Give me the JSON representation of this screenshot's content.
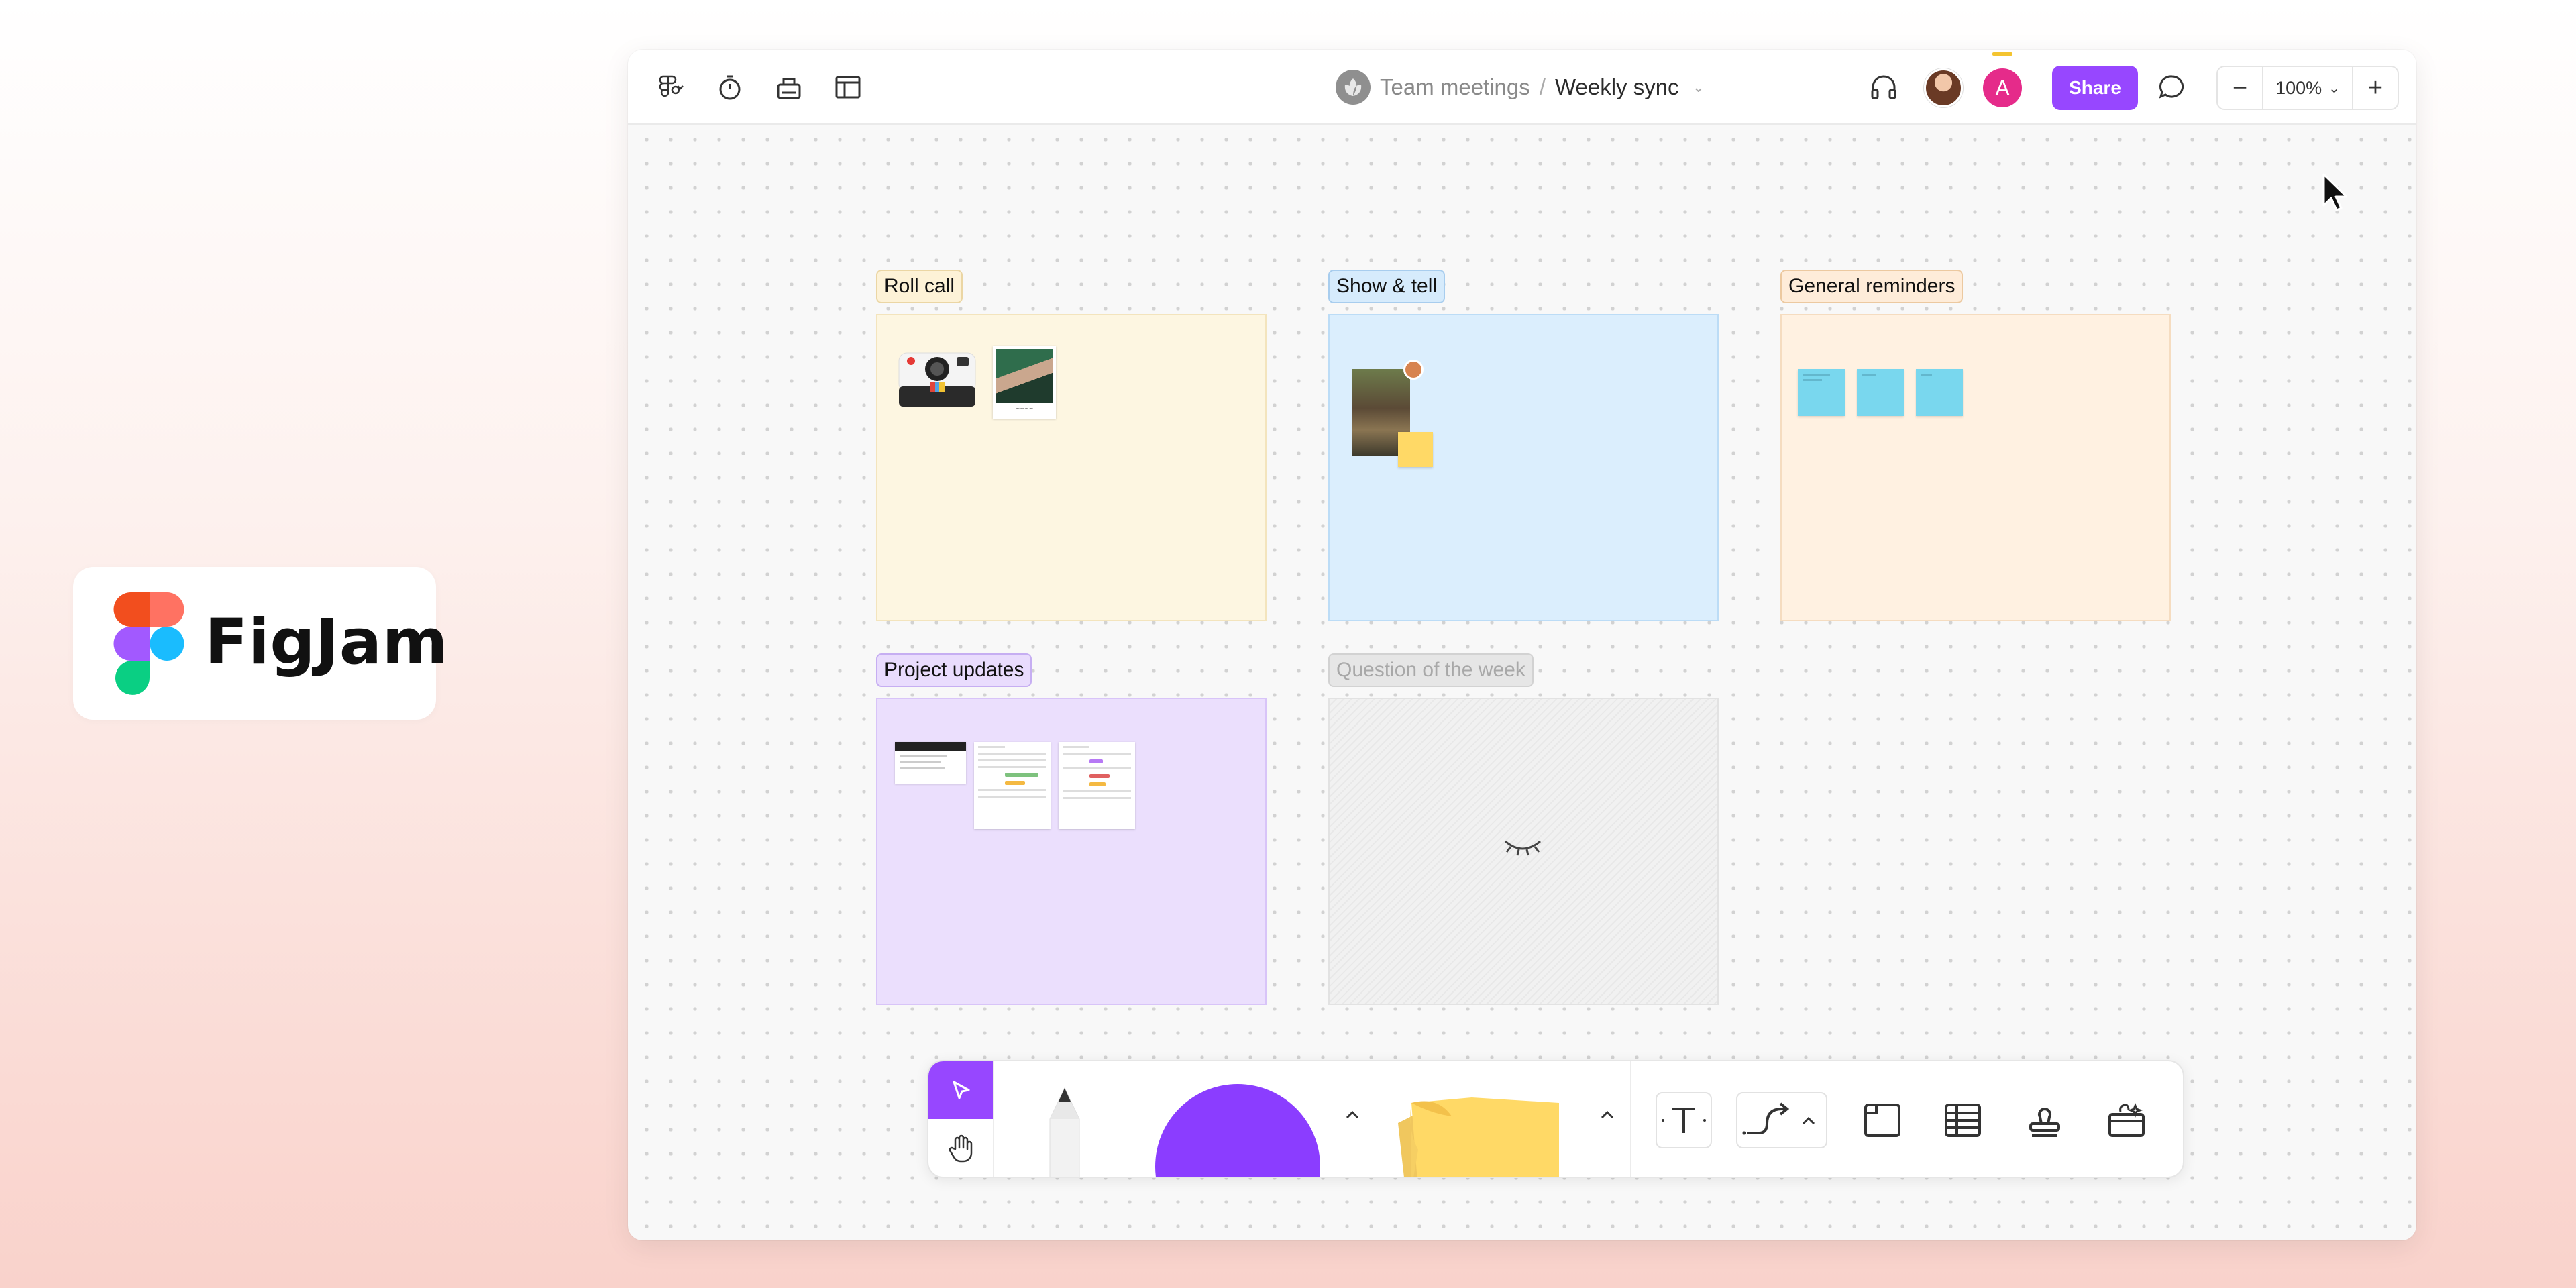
{
  "brand": {
    "name": "FigJam",
    "logo_colors": [
      "#f24e1e",
      "#ff7262",
      "#a259ff",
      "#1abcfe",
      "#0acf83"
    ]
  },
  "header": {
    "team": "Team meetings",
    "separator": "/",
    "file_name": "Weekly sync",
    "share_label": "Share",
    "avatar_initial": "A",
    "zoom": "100%",
    "zoom_out": "−",
    "zoom_in": "+"
  },
  "sections": [
    {
      "title": "Roll call",
      "color": "#fdf6e1"
    },
    {
      "title": "Show & tell",
      "color": "#dbeefd"
    },
    {
      "title": "General reminders",
      "color": "#fff1e1"
    },
    {
      "title": "Project updates",
      "color": "#ebdffd"
    },
    {
      "title": "Question of the week",
      "color": "#f1f1f1",
      "hidden": true
    }
  ],
  "toolbar": {
    "tools": [
      "select-tool",
      "hand-tool",
      "marker-tool",
      "shape-tool",
      "sticky-note-tool",
      "text-tool",
      "connector-tool",
      "section-tool",
      "table-tool",
      "stamp-tool",
      "widgets-tool"
    ],
    "shape_color": "#8b3dff",
    "sticky_color": "#ffd966",
    "accent": "#9747ff"
  }
}
